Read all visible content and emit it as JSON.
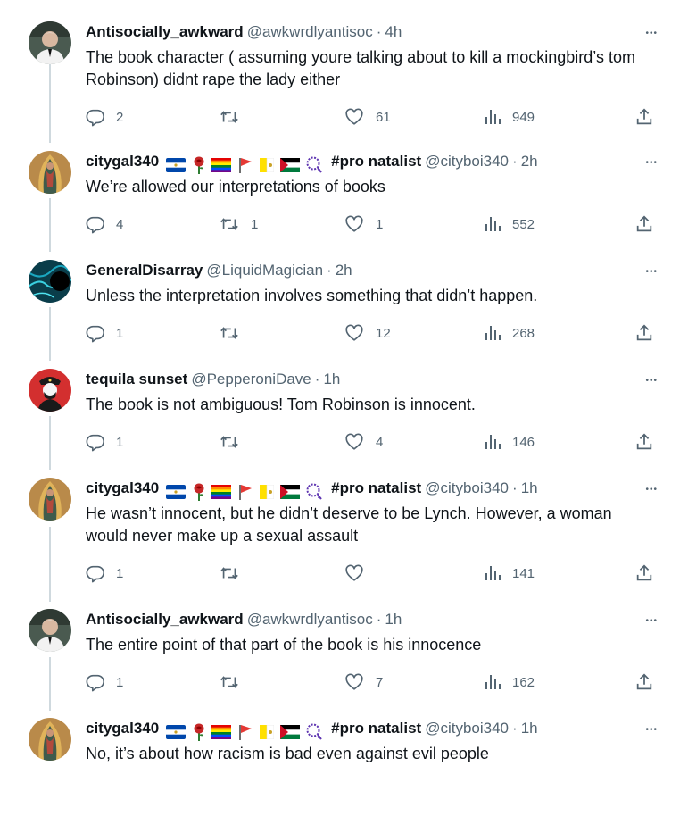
{
  "colors": {
    "text": "#0f1419",
    "muted": "#536471",
    "thread_line": "#cfd9de",
    "background": "#ffffff"
  },
  "icons": {
    "reply": "reply-icon",
    "retweet": "retweet-icon",
    "like": "like-icon",
    "views": "views-icon",
    "share": "share-icon",
    "more": "more-icon"
  },
  "tweets": [
    {
      "name": "Antisocially_awkward",
      "handle": "@awkwrdlyantisoc",
      "time": "4h",
      "text": "The book character ( assuming youre talking about to kill a mockingbird’s tom Robinson) didnt rape the lady either",
      "replies": "2",
      "retweets": "",
      "likes": "61",
      "views": "949"
    },
    {
      "name": "citygal340",
      "badge_text": "#pro natalist",
      "handle": "@cityboi340",
      "time": "2h",
      "text": "We’re allowed our interpretations of books",
      "replies": "4",
      "retweets": "1",
      "likes": "1",
      "views": "552"
    },
    {
      "name": "GeneralDisarray",
      "handle": "@LiquidMagician",
      "time": "2h",
      "text": "Unless the interpretation involves something that didn’t happen.",
      "replies": "1",
      "retweets": "",
      "likes": "12",
      "views": "268"
    },
    {
      "name": "tequila sunset",
      "handle": "@PepperoniDave",
      "time": "1h",
      "text": "The book is not ambiguous!  Tom Robinson is innocent.",
      "replies": "1",
      "retweets": "",
      "likes": "4",
      "views": "146"
    },
    {
      "name": "citygal340",
      "badge_text": "#pro natalist",
      "handle": "@cityboi340",
      "time": "1h",
      "text": "He wasn’t innocent, but he didn’t deserve to be Lynch. However, a woman would never make up a sexual assault",
      "replies": "1",
      "retweets": "",
      "likes": "",
      "views": "141"
    },
    {
      "name": "Antisocially_awkward",
      "handle": "@awkwrdlyantisoc",
      "time": "1h",
      "text": "The entire point of that part of the book is his innocence",
      "replies": "1",
      "retweets": "",
      "likes": "7",
      "views": "162"
    },
    {
      "name": "citygal340",
      "badge_text": "#pro natalist",
      "handle": "@cityboi340",
      "time": "1h",
      "text": "No, it’s about how racism is bad even against evil people"
    }
  ]
}
